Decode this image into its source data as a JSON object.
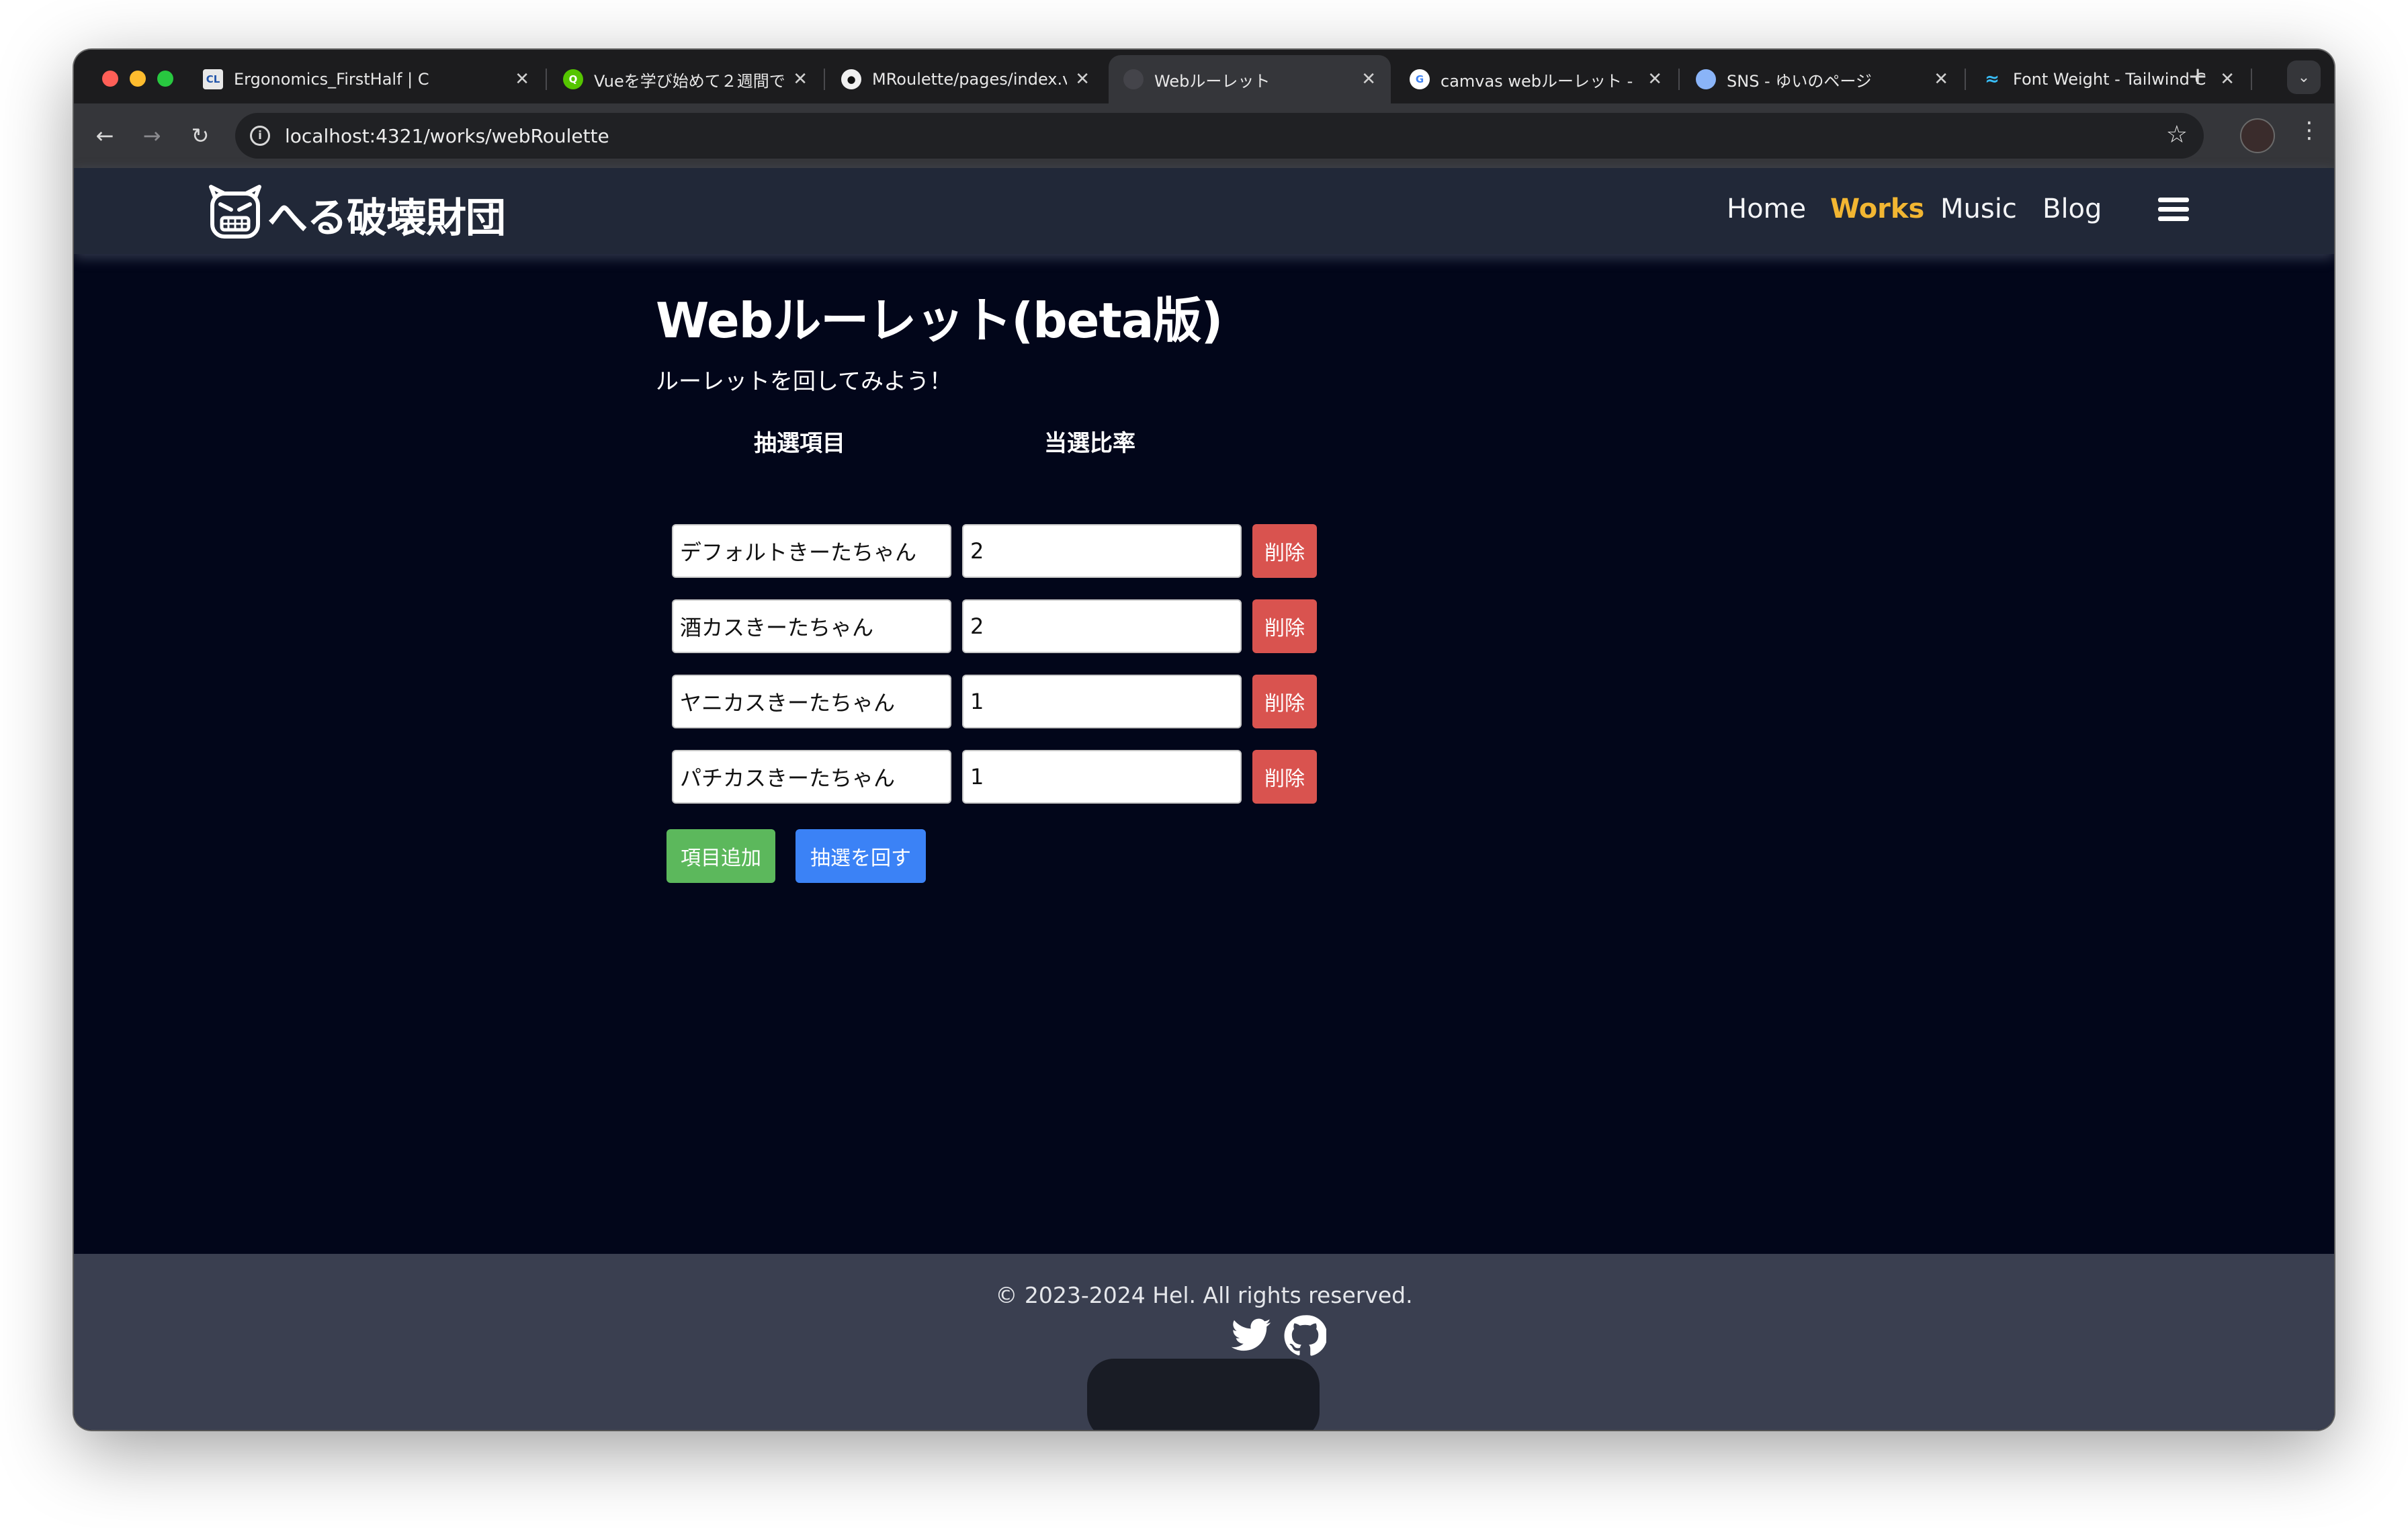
{
  "browser": {
    "tabs": [
      {
        "title": "Ergonomics_FirstHalf | C",
        "icon": "cl-favicon"
      },
      {
        "title": "Vueを学び始めて２週間で作",
        "icon": "qiita-favicon"
      },
      {
        "title": "MRoulette/pages/index.v",
        "icon": "github-favicon"
      },
      {
        "title": "Webルーレット",
        "icon": "site-favicon"
      },
      {
        "title": "camvas webルーレット - ",
        "icon": "google-favicon"
      },
      {
        "title": "SNS - ゆいのページ",
        "icon": "globe-favicon"
      },
      {
        "title": "Font Weight - Tailwind C",
        "icon": "tailwind-favicon"
      }
    ],
    "url": "localhost:4321/works/webRoulette"
  },
  "site": {
    "title": "へる破壊財団",
    "nav": [
      "Home",
      "Works",
      "Music",
      "Blog"
    ],
    "active_nav": "Works",
    "accent": "#f2b632"
  },
  "content": {
    "title": "Webルーレット(beta版)",
    "subtitle": "ルーレットを回してみよう！",
    "col_item": "抽選項目",
    "col_ratio": "当選比率",
    "rows": [
      {
        "item": "デフォルトきーたちゃん",
        "ratio": "2",
        "delete": "削除"
      },
      {
        "item": "酒カスきーたちゃん",
        "ratio": "2",
        "delete": "削除"
      },
      {
        "item": "ヤニカスきーたちゃん",
        "ratio": "1",
        "delete": "削除"
      },
      {
        "item": "パチカスきーたちゃん",
        "ratio": "1",
        "delete": "削除"
      }
    ],
    "add_label": "項目追加",
    "spin_label": "抽選を回す"
  },
  "footer": {
    "copyright": "© 2023-2024 Hel. All rights reserved.",
    "icons": [
      "twitter-icon",
      "github-icon"
    ]
  }
}
